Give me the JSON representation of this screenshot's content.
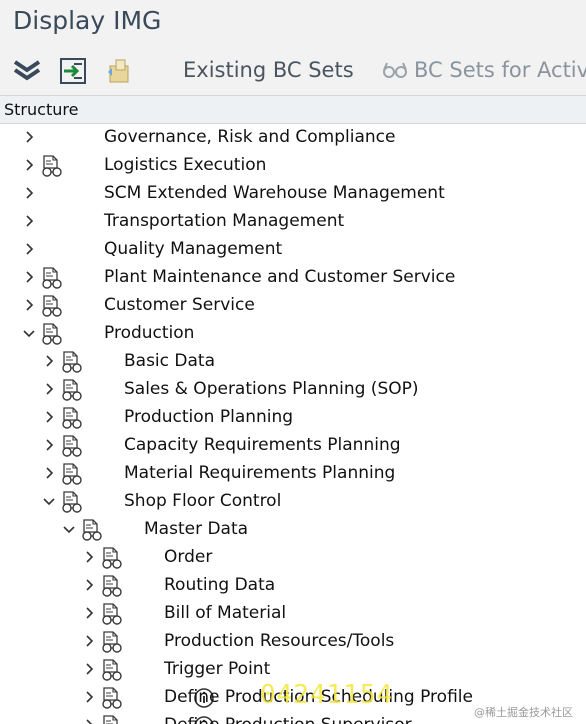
{
  "window": {
    "title": "Display IMG"
  },
  "toolbar": {
    "buttons": [
      {
        "icon": "collapse-all-icon"
      },
      {
        "icon": "execute-icon"
      },
      {
        "icon": "transport-icon"
      }
    ],
    "existing_bc_sets_label": "Existing BC Sets",
    "bc_sets_activity_label": "BC Sets for Activit"
  },
  "tree": {
    "column_header": "Structure",
    "rows": [
      {
        "label": "Governance, Risk and Compliance",
        "expanded": false,
        "has_icon": false
      },
      {
        "label": "Logistics Execution",
        "expanded": false,
        "has_icon": true
      },
      {
        "label": "SCM Extended Warehouse Management",
        "expanded": false,
        "has_icon": false
      },
      {
        "label": "Transportation Management",
        "expanded": false,
        "has_icon": false
      },
      {
        "label": "Quality Management",
        "expanded": false,
        "has_icon": false
      },
      {
        "label": "Plant Maintenance and Customer Service",
        "expanded": false,
        "has_icon": true
      },
      {
        "label": "Customer Service",
        "expanded": false,
        "has_icon": true
      },
      {
        "label": "Production",
        "expanded": true,
        "has_icon": true
      },
      {
        "label": "Basic Data",
        "expanded": false,
        "has_icon": true
      },
      {
        "label": "Sales & Operations Planning (SOP)",
        "expanded": false,
        "has_icon": true
      },
      {
        "label": "Production Planning",
        "expanded": false,
        "has_icon": true
      },
      {
        "label": "Capacity Requirements Planning",
        "expanded": false,
        "has_icon": true
      },
      {
        "label": "Material Requirements Planning",
        "expanded": false,
        "has_icon": true
      },
      {
        "label": "Shop Floor Control",
        "expanded": true,
        "has_icon": true
      },
      {
        "label": "Master Data",
        "expanded": true,
        "has_icon": true
      },
      {
        "label": "Order",
        "expanded": false,
        "has_icon": true
      },
      {
        "label": "Routing Data",
        "expanded": false,
        "has_icon": true
      },
      {
        "label": "Bill of Material",
        "expanded": false,
        "has_icon": true
      },
      {
        "label": "Production Resources/Tools",
        "expanded": false,
        "has_icon": true
      },
      {
        "label": "Trigger Point",
        "expanded": false,
        "has_icon": true
      },
      {
        "label": "Define Production Scheduling Profile",
        "expanded": false,
        "has_icon": true,
        "activity": true
      },
      {
        "label": "Define Production Supervisor",
        "expanded": false,
        "has_icon": true,
        "activity": true
      }
    ]
  },
  "overlay": {
    "watermark_text": "04241154",
    "site_credit": "@稀土掘金技术社区"
  }
}
